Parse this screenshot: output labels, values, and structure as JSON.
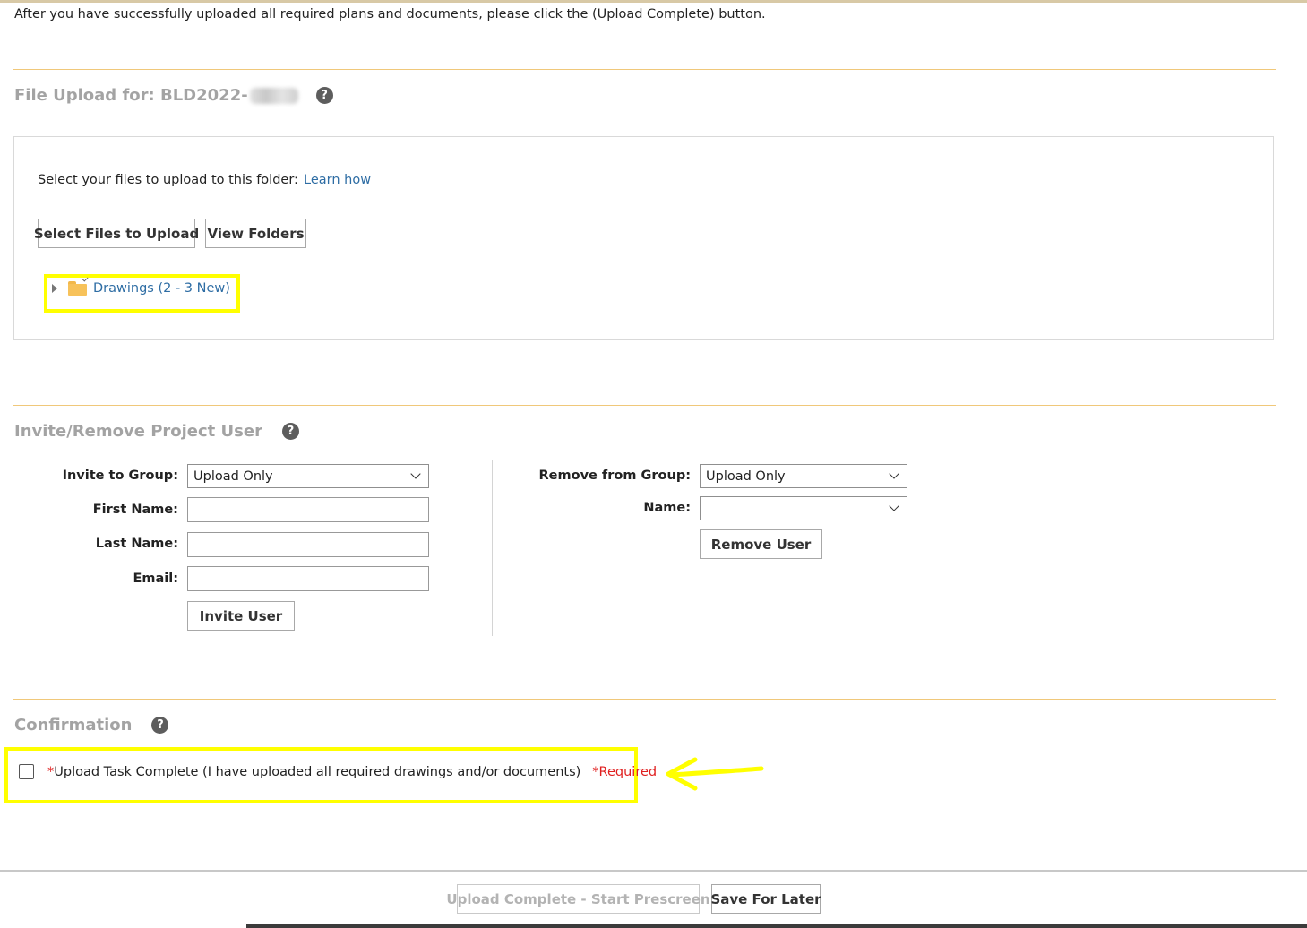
{
  "intro": "After you have successfully uploaded all required plans and documents, please click the (Upload Complete) button.",
  "file_upload": {
    "title": "File Upload for: BLD2022-",
    "select_text": "Select your files to upload to this folder:",
    "learn_link": "Learn how",
    "select_files_btn": "Select Files to Upload",
    "view_folders_btn": "View Folders",
    "folder_label": "Drawings (2 - 3 New)"
  },
  "invite": {
    "title": "Invite/Remove Project User",
    "invite_group_label": "Invite to Group:",
    "invite_group_value": "Upload Only",
    "first_name_label": "First Name:",
    "first_name_value": "",
    "last_name_label": "Last Name:",
    "last_name_value": "",
    "email_label": "Email:",
    "email_value": "",
    "invite_btn": "Invite User",
    "remove_group_label": "Remove from Group:",
    "remove_group_value": "Upload Only",
    "name_label": "Name:",
    "name_value": "",
    "remove_btn": "Remove User"
  },
  "confirmation": {
    "title": "Confirmation",
    "star": "*",
    "checkbox_label": "Upload Task Complete (I have uploaded all required drawings and/or documents)",
    "required": "*Required"
  },
  "footer": {
    "upload_complete_btn": "Upload Complete - Start Prescreen",
    "save_later_btn": "Save For Later"
  },
  "colors": {
    "highlight": "#ffff00",
    "rule": "#f0c87a",
    "link": "#2e6da4",
    "required": "#e02020"
  },
  "icons": [
    "help-icon",
    "folder-icon",
    "caret-right-icon",
    "chevron-down-icon",
    "arrow-left-icon"
  ]
}
